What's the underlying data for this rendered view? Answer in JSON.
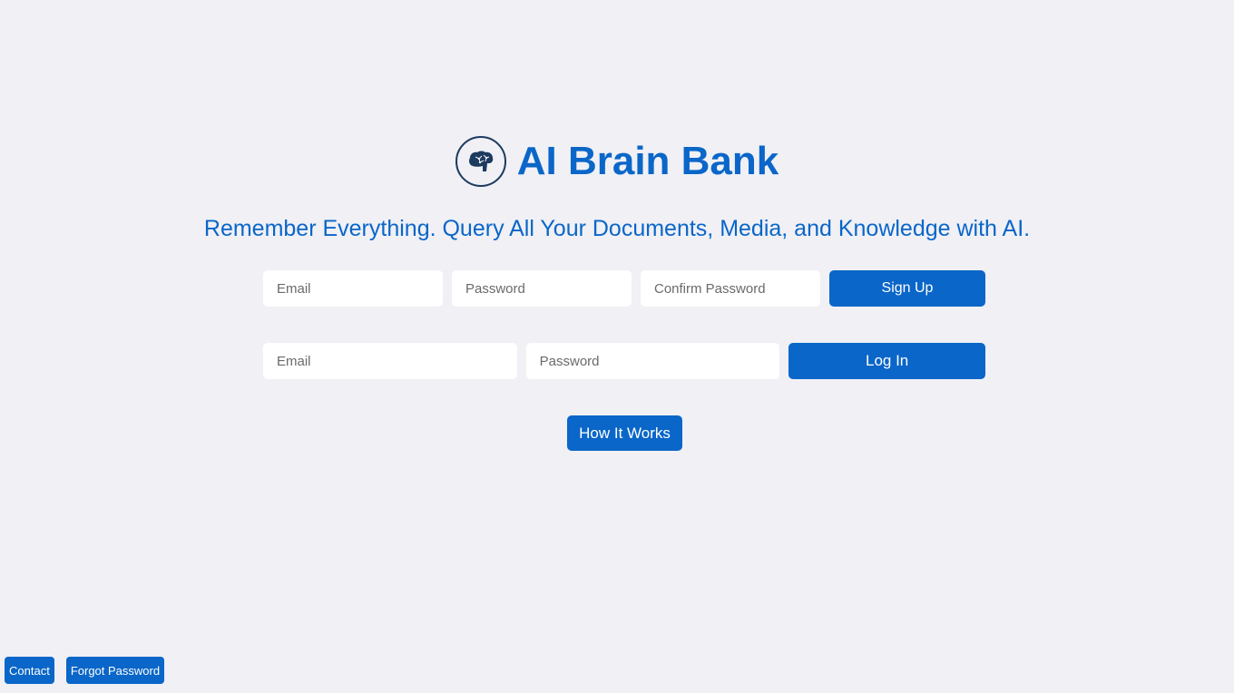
{
  "header": {
    "logo_icon": "brain-icon",
    "title": "AI Brain Bank",
    "tagline": "Remember Everything. Query All Your Documents, Media, and Knowledge with AI."
  },
  "signup": {
    "email_placeholder": "Email",
    "password_placeholder": "Password",
    "confirm_placeholder": "Confirm Password",
    "button_label": "Sign Up"
  },
  "login": {
    "email_placeholder": "Email",
    "password_placeholder": "Password",
    "button_label": "Log In"
  },
  "how_it_works_label": "How It Works",
  "footer": {
    "contact_label": "Contact",
    "forgot_label": "Forgot Password"
  },
  "colors": {
    "accent": "#0a66c8",
    "background": "#f0f0f5",
    "logo_dark": "#1d3a5f"
  }
}
